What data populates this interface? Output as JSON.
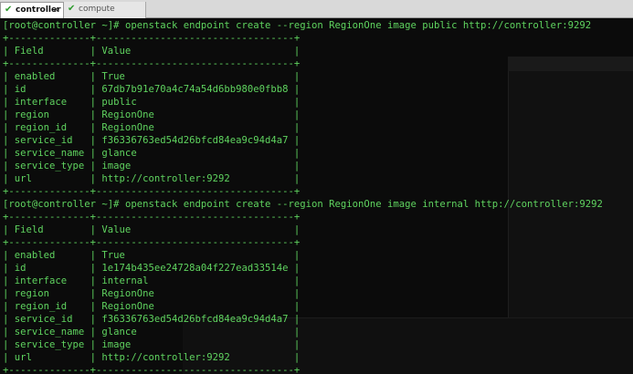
{
  "tabs": [
    {
      "label": "controller",
      "active": true,
      "status_icon": "check-icon",
      "close": "×"
    },
    {
      "label": "compute",
      "active": false,
      "status_icon": "check-icon"
    }
  ],
  "colors": {
    "terminal_bg": "#0b0b0b",
    "terminal_text": "#d4d4d4",
    "prompt_green": "#5fd35f",
    "tab_bg": "#d9d9d9"
  },
  "terminal": {
    "blocks": [
      {
        "prompt": "[root@controller ~]#",
        "command": " openstack endpoint create --region RegionOne image public http://controller:9292",
        "border": "+--------------+----------------------------------+",
        "header": "| Field        | Value                            |",
        "rows": [
          "| enabled      | True                             |",
          "| id           | 67db7b91e70a4c74a54d6bb980e0fbb8 |",
          "| interface    | public                           |",
          "| region       | RegionOne                        |",
          "| region_id    | RegionOne                        |",
          "| service_id   | f36336763ed54d26bfcd84ea9c94d4a7 |",
          "| service_name | glance                           |",
          "| service_type | image                            |",
          "| url          | http://controller:9292           |"
        ]
      },
      {
        "prompt": "[root@controller ~]#",
        "command": " openstack endpoint create --region RegionOne image internal http://controller:9292",
        "border": "+--------------+----------------------------------+",
        "header": "| Field        | Value                            |",
        "rows": [
          "| enabled      | True                             |",
          "| id           | 1e174b435ee24728a04f227ead33514e |",
          "| interface    | internal                         |",
          "| region       | RegionOne                        |",
          "| region_id    | RegionOne                        |",
          "| service_id   | f36336763ed54d26bfcd84ea9c94d4a7 |",
          "| service_name | glance                           |",
          "| service_type | image                            |",
          "| url          | http://controller:9292           |"
        ]
      }
    ]
  }
}
